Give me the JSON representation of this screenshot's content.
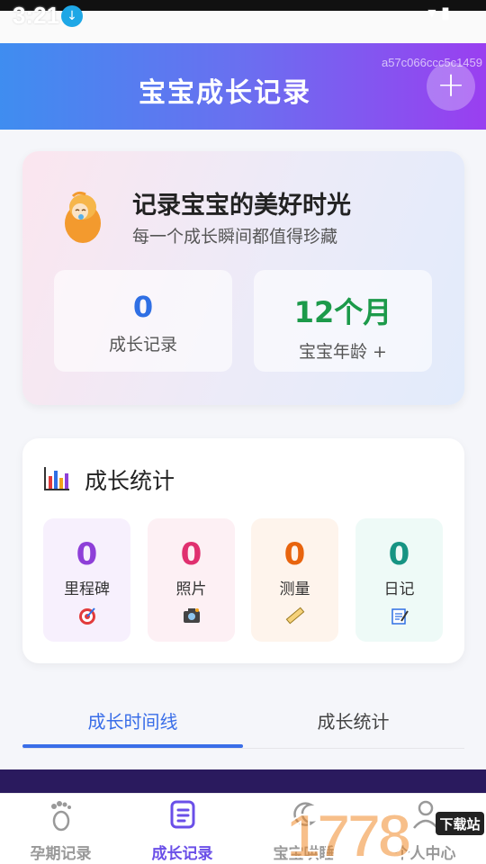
{
  "status_bar": {
    "time": "3:21",
    "download_icon": "download-icon"
  },
  "header": {
    "title": "宝宝成长记录",
    "watermark": "a57c066ccc5c1459",
    "add_label": "+"
  },
  "hero": {
    "title": "记录宝宝的美好时光",
    "subtitle": "每一个成长瞬间都值得珍藏",
    "records": {
      "value": "0",
      "label": "成长记录"
    },
    "age": {
      "value": "12个月",
      "label": "宝宝年龄 +"
    }
  },
  "growth_stats": {
    "title": "成长统计",
    "tiles": [
      {
        "value": "0",
        "label": "里程碑",
        "icon": "target-icon",
        "color": "#8e3fd8",
        "bg": "#f7f0fd"
      },
      {
        "value": "0",
        "label": "照片",
        "icon": "camera-icon",
        "color": "#e0306f",
        "bg": "#fdf0f4"
      },
      {
        "value": "0",
        "label": "测量",
        "icon": "ruler-icon",
        "color": "#e8640e",
        "bg": "#fef4ec"
      },
      {
        "value": "0",
        "label": "日记",
        "icon": "notepad-icon",
        "color": "#169483",
        "bg": "#eefaf7"
      }
    ]
  },
  "tabs": [
    {
      "label": "成长时间线",
      "active": true
    },
    {
      "label": "成长统计",
      "active": false
    }
  ],
  "bottom_nav": [
    {
      "label": "孕期记录",
      "icon": "footprint-icon",
      "active": false
    },
    {
      "label": "成长记录",
      "icon": "notebook-icon",
      "active": true
    },
    {
      "label": "宝宝哄睡",
      "icon": "moon-icon",
      "active": false
    },
    {
      "label": "个人中心",
      "icon": "person-icon",
      "active": false
    }
  ],
  "brand_watermark": {
    "number": "1778",
    "tag": "下载站"
  },
  "colors": {
    "accent": "#3a6ee8",
    "records": "#2f6fe4",
    "age": "#1c9a4a",
    "nav_active": "#6a4fe8"
  }
}
